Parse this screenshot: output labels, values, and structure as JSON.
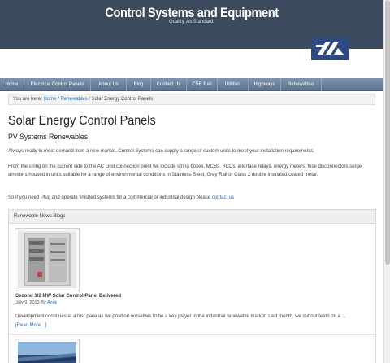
{
  "header": {
    "site_title": "Control Systems and Equipment",
    "tagline": "Quality. As Standard.",
    "logo_alt": "CSE logo",
    "bg_color": "#3b4a5c"
  },
  "nav": {
    "items": [
      {
        "label": "Home"
      },
      {
        "label": "Electrical Control Panels"
      },
      {
        "label": "About Us"
      },
      {
        "label": "Blog"
      },
      {
        "label": "Contact Us"
      },
      {
        "label": "CSE Rail"
      },
      {
        "label": "Utilities"
      },
      {
        "label": "Highways"
      },
      {
        "label": "Renewables"
      }
    ]
  },
  "breadcrumb": {
    "prefix": "You are here:",
    "home": "Home",
    "sep1": "/",
    "section": "Renewables",
    "sep2": "/",
    "current": "Solar Energy Control Panels"
  },
  "main": {
    "title": "Solar Energy Control Panels",
    "subtitle": "PV Systems Renewables",
    "para1": "Always ready to meet demand from a new market, Control Systems can supply a range of custom units to meet your installation requirements.",
    "para2": "From the string on the current side to the AC Grid connection point we include string boxes, MCBs, RCDs, interface relays, energy meters, fuse disconnectors,surge arresters housed in units suitable for a range of environmental conditions in Stainless Steel, Grey Rail or Class 2 double insulated coated metal.",
    "para3_prefix": "So if you need Plug and operate finished systems for a commercial or industrial design please",
    "para3_link": "contact us"
  },
  "widget": {
    "title": "Renewable News Blogs",
    "post": {
      "title": "Second 1/2 MW Solar Control Panel Delivered",
      "date": "July 9, 2013",
      "by": "By",
      "author": "Andy",
      "excerpt": "Development continues at a fast pace as we position ourselves to be a key player in the industrial renewable market. Last month, we cut out teeth on a ...",
      "read_more": "[Read More...]"
    }
  }
}
